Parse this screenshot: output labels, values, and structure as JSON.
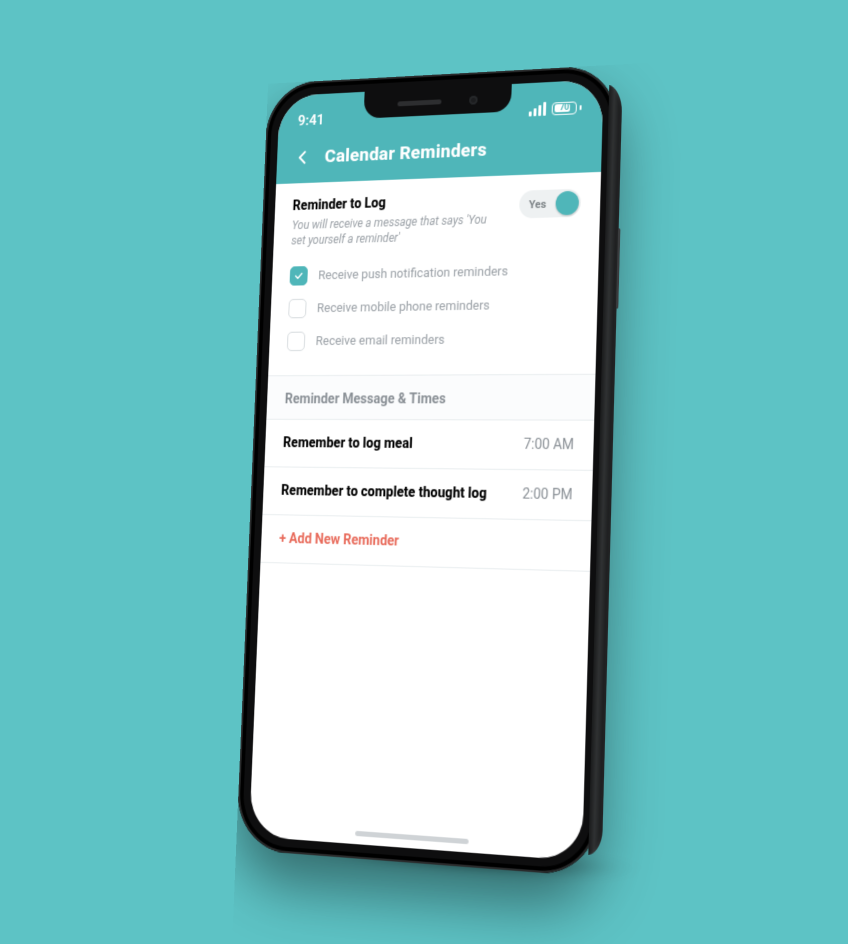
{
  "status": {
    "time": "9:41",
    "battery": "70"
  },
  "header": {
    "title": "Calendar Reminders"
  },
  "reminder_to_log": {
    "title": "Reminder to Log",
    "description": "You will receive a message that says 'You set yourself a reminder'",
    "toggle_label": "Yes"
  },
  "checkboxes": {
    "push": {
      "label": "Receive push notification reminders",
      "checked": true
    },
    "phone": {
      "label": "Receive mobile phone reminders",
      "checked": false
    },
    "email": {
      "label": "Receive email reminders",
      "checked": false
    }
  },
  "section_title": "Reminder Message & Times",
  "reminders": [
    {
      "name": "Remember to log meal",
      "time": "7:00 AM"
    },
    {
      "name": "Remember to complete thought log",
      "time": "2:00 PM"
    }
  ],
  "add_new": "+ Add New Reminder",
  "colors": {
    "accent": "#4fb6b9",
    "danger": "#e86a5a"
  }
}
